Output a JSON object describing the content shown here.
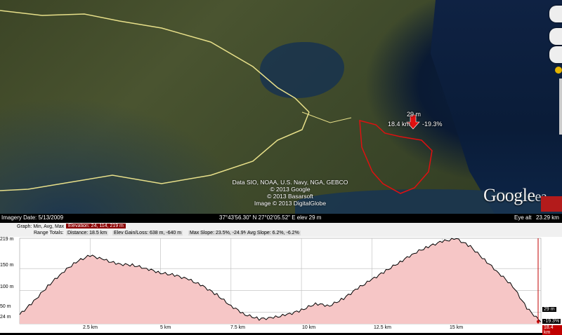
{
  "map": {
    "route_labels": {
      "top": "29 m",
      "left": "18.4 km",
      "right": "-19.3%"
    },
    "attribution": [
      "Data SIO, NOAA, U.S. Navy, NGA, GEBCO",
      "© 2013 Google",
      "© 2013 Basarsoft",
      "Image © 2013 DigitalGlobe"
    ],
    "logo_text": "Google",
    "logo_tail": "ea",
    "colors": {
      "route": "#e01010",
      "roads": "#e8e08a",
      "sea": "#0b1d3a"
    }
  },
  "status_bar": {
    "imagery_date": "Imagery Date: 5/13/2009",
    "coordinates": "37°43'56.30\" N  27°02'05.52\" E  elev   29 m",
    "eye_alt_label": "Eye alt",
    "eye_alt_value": "23.29 km"
  },
  "profile": {
    "graph_label": "Graph: Min, Avg, Max",
    "elevation": "Elevation: 24, 114, 219 m",
    "range_totals_label": "Range Totals:",
    "distance": "Distance: 18.5 km",
    "elev_gain_loss": "Elev Gain/Loss: 638 m, -640 m",
    "max_slope": "Max Slope: 23.5%, -24.9%",
    "avg_slope": "Avg Slope: 6.2%, -6.2%",
    "cursor_elevation": "29 m",
    "cursor_slope": "-19.3%",
    "cursor_distance": "18.4 km"
  },
  "chart_data": {
    "type": "area",
    "x_tick_labels": [
      "2.5 km",
      "5 km",
      "7.5 km",
      "10 km",
      "12.5 km",
      "15 km"
    ],
    "y_tick_labels": [
      "219 m",
      "150 m",
      "100 m",
      "50 m",
      "24 m"
    ],
    "xlim": [
      0,
      18.5
    ],
    "ylim": [
      24,
      219
    ],
    "x": [
      0,
      0.5,
      1,
      1.5,
      2,
      2.5,
      3,
      3.5,
      4,
      4.5,
      5,
      5.5,
      6,
      6.5,
      7,
      7.5,
      8,
      8.5,
      9,
      9.5,
      10,
      10.5,
      11,
      11.5,
      12,
      12.5,
      13,
      13.5,
      14,
      14.5,
      15,
      15.5,
      16,
      16.5,
      17,
      17.5,
      18,
      18.5
    ],
    "y": [
      45,
      75,
      110,
      140,
      165,
      180,
      170,
      160,
      158,
      150,
      140,
      135,
      125,
      110,
      90,
      65,
      45,
      35,
      38,
      45,
      55,
      70,
      65,
      82,
      105,
      125,
      145,
      165,
      185,
      200,
      212,
      218,
      200,
      170,
      140,
      110,
      60,
      28
    ],
    "colors": {
      "fill": "#f6c6c6",
      "line": "#000000",
      "marker": "#c00000"
    }
  }
}
